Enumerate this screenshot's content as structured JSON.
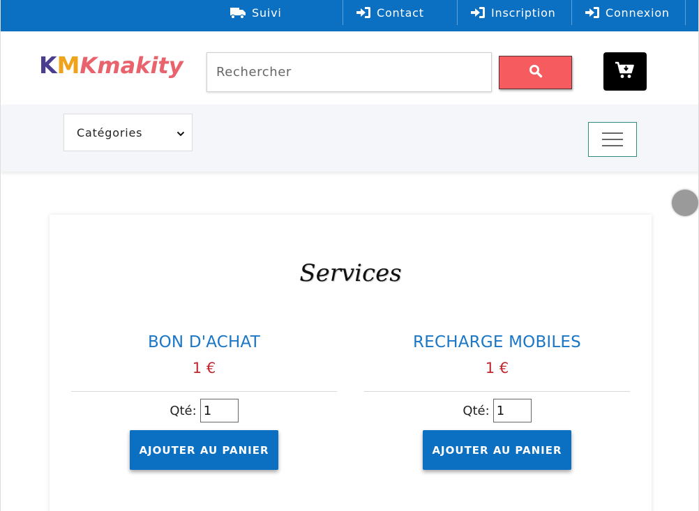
{
  "topnav": {
    "items": [
      {
        "label": "Suivi",
        "icon": "truck-icon"
      },
      {
        "label": "Contact",
        "icon": "sign-in-icon"
      },
      {
        "label": "Inscription",
        "icon": "sign-in-icon"
      },
      {
        "label": "Connexion",
        "icon": "sign-in-icon"
      }
    ]
  },
  "header": {
    "logo": {
      "k": "K",
      "m": "M",
      "rest": "Kmakity"
    },
    "search": {
      "placeholder": "Rechercher",
      "icon": "search-icon"
    },
    "cart": {
      "icon": "cart-download-icon"
    }
  },
  "catbar": {
    "select_label": "Catégories",
    "menu_icon": "hamburger-icon"
  },
  "section": {
    "title": "Services",
    "products": [
      {
        "name": "BON D'ACHAT",
        "price": "1 €",
        "qty_label": "Qté:",
        "qty": "1",
        "button": "AJOUTER AU PANIER"
      },
      {
        "name": "RECHARGE MOBILES",
        "price": "1 €",
        "qty_label": "Qté:",
        "qty": "1",
        "button": "AJOUTER AU PANIER"
      }
    ]
  },
  "colors": {
    "primary": "#0b6fc2",
    "search_button": "#f55b5f",
    "price": "#c0262e",
    "product_name": "#1a76c6"
  }
}
